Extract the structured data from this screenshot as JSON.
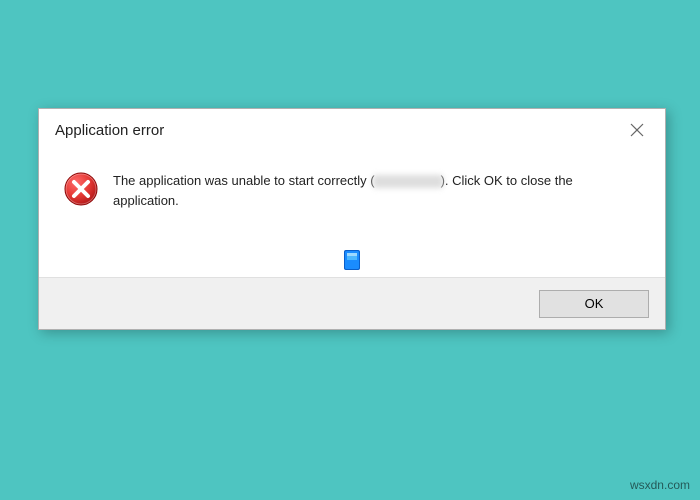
{
  "dialog": {
    "title": "Application error",
    "message_prefix": "The application was unable to start correctly (",
    "message_suffix": "). Click OK to close the application.",
    "ok_label": "OK"
  },
  "watermark": "wsxdn.com",
  "colors": {
    "background": "#4ec5c1",
    "error_red": "#d32f2f",
    "button_bar": "#f0f0f0"
  }
}
